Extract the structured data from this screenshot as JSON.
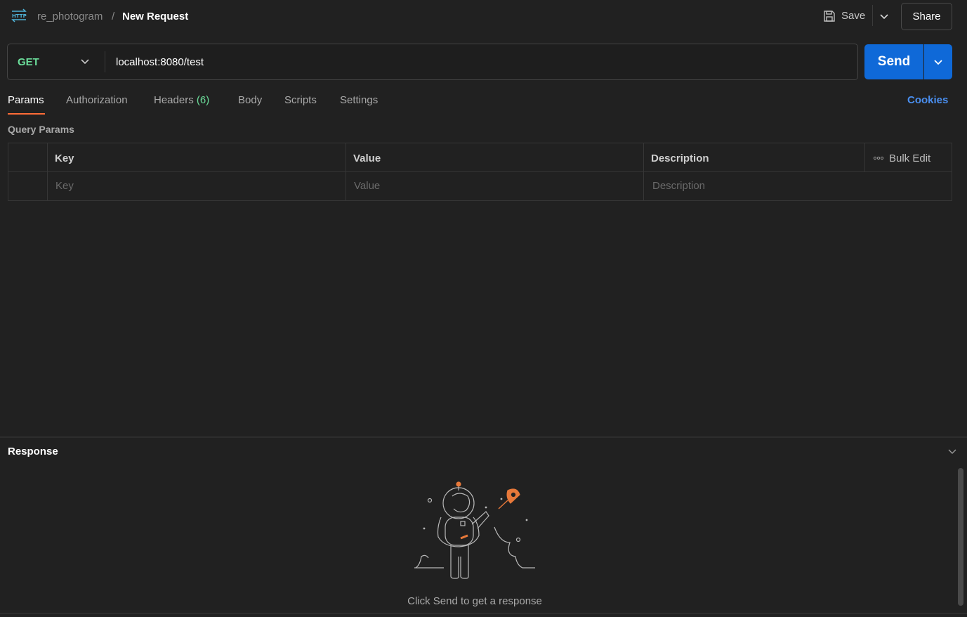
{
  "header": {
    "breadcrumb_parent": "re_photogram",
    "breadcrumb_separator": "/",
    "breadcrumb_current": "New Request",
    "save_label": "Save",
    "share_label": "Share"
  },
  "request": {
    "method": "GET",
    "url": "localhost:8080/test",
    "send_label": "Send"
  },
  "tabs": [
    {
      "label": "Params",
      "active": true
    },
    {
      "label": "Authorization"
    },
    {
      "label": "Headers",
      "count": "(6)"
    },
    {
      "label": "Body"
    },
    {
      "label": "Scripts"
    },
    {
      "label": "Settings"
    }
  ],
  "cookies_label": "Cookies",
  "query_params": {
    "title": "Query Params",
    "columns": [
      "Key",
      "Value",
      "Description"
    ],
    "placeholders": [
      "Key",
      "Value",
      "Description"
    ],
    "bulk_edit_label": "Bulk Edit"
  },
  "response": {
    "title": "Response",
    "empty_message": "Click Send to get a response"
  },
  "colors": {
    "accent": "#ff6c37",
    "send_button": "#0f69d8",
    "method_get": "#6bdd9a",
    "link": "#4a8ff0",
    "background": "#212121"
  },
  "icons": {
    "http": "http-icon",
    "save": "save-icon",
    "chevron": "chevron-down-icon",
    "more": "more-horizontal-icon",
    "illustration": "astronaut-rocket-illustration"
  }
}
